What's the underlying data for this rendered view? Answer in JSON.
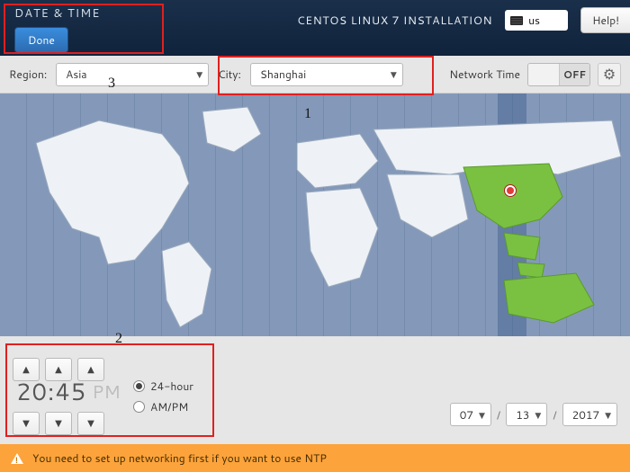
{
  "header": {
    "title": "DATE & TIME",
    "done_label": "Done",
    "install_title": "CENTOS LINUX 7 INSTALLATION",
    "keyboard_layout": "us",
    "help_label": "Help!"
  },
  "toolbar": {
    "region_label": "Region:",
    "region_value": "Asia",
    "city_label": "City:",
    "city_value": "Shanghai",
    "network_time_label": "Network Time",
    "network_time_state": "OFF"
  },
  "map": {
    "selected_city": "Shanghai",
    "selected_region": "Asia"
  },
  "time": {
    "hours": "20",
    "minutes": "45",
    "ampm": "PM",
    "format_24_label": "24-hour",
    "format_ampm_label": "AM/PM",
    "format_selected": "24-hour"
  },
  "date": {
    "month": "07",
    "day": "13",
    "year": "2017"
  },
  "warning": {
    "text": "You need to set up networking first if you want to use NTP"
  },
  "annotations": {
    "n1": "1",
    "n2": "2",
    "n3": "3"
  }
}
